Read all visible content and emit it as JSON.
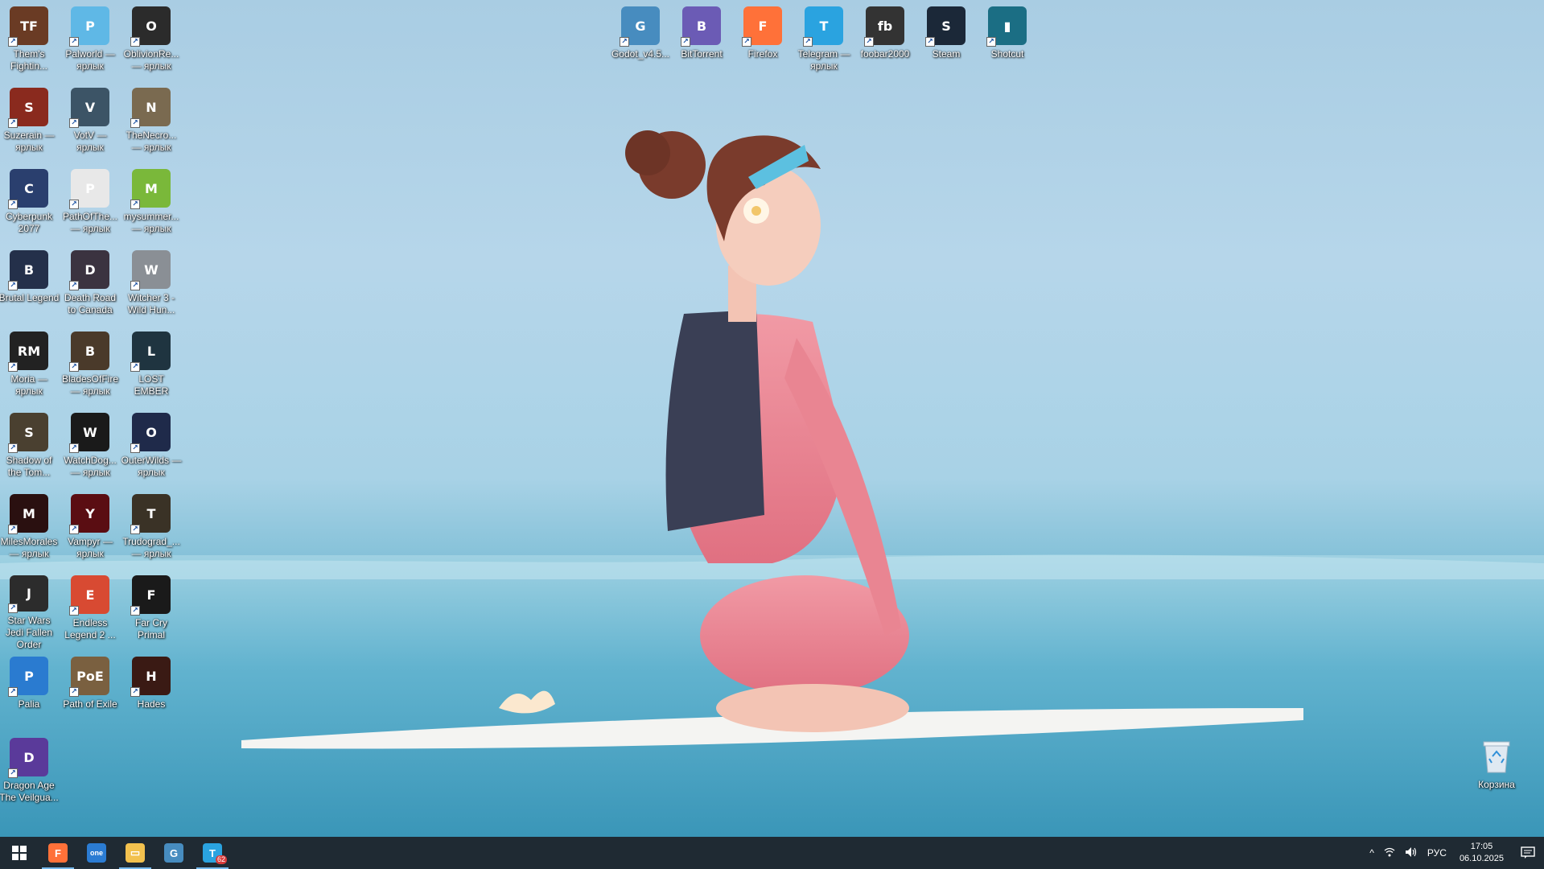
{
  "desktop": {
    "top_icons": [
      {
        "label": "Godot_v4.5...",
        "icon": "godot-icon",
        "color": "#478cbf",
        "glyph": "G"
      },
      {
        "label": "BitTorrent",
        "icon": "bittorrent-icon",
        "color": "#6b5bb5",
        "glyph": "B"
      },
      {
        "label": "Firefox",
        "icon": "firefox-icon",
        "color": "#ff7139",
        "glyph": "F"
      },
      {
        "label": "Telegram — ярлык",
        "icon": "telegram-icon",
        "color": "#2aa3e0",
        "glyph": "T"
      },
      {
        "label": "foobar2000",
        "icon": "foobar-icon",
        "color": "#333333",
        "glyph": "fb"
      },
      {
        "label": "Steam",
        "icon": "steam-icon",
        "color": "#1b2838",
        "glyph": "S"
      },
      {
        "label": "Shotcut",
        "icon": "shotcut-icon",
        "color": "#1b6e84",
        "glyph": "▮"
      }
    ],
    "column_icons": [
      {
        "label": "Them's Fightin...",
        "icon": "thems-fightin-herds-icon",
        "color": "#6a3b24",
        "glyph": "TF"
      },
      {
        "label": "Palworld — ярлык",
        "icon": "palworld-icon",
        "color": "#5fb8e6",
        "glyph": "P"
      },
      {
        "label": "OblivionRe... — ярлык",
        "icon": "oblivion-icon",
        "color": "#2b2b2b",
        "glyph": "O"
      },
      {
        "label": "Suzerain — ярлык",
        "icon": "suzerain-icon",
        "color": "#8a2a1e",
        "glyph": "S"
      },
      {
        "label": "VotV — ярлык",
        "icon": "votv-icon",
        "color": "#3c5466",
        "glyph": "V"
      },
      {
        "label": "TheNecro... — ярлык",
        "icon": "necromancer-icon",
        "color": "#7a6a50",
        "glyph": "N"
      },
      {
        "label": "Cyberpunk 2077",
        "icon": "cyberpunk-icon",
        "color": "#2a3f6e",
        "glyph": "C"
      },
      {
        "label": "PathOfThe... — ярлык",
        "icon": "path-of-the-icon",
        "color": "#e8e8e8",
        "glyph": "P"
      },
      {
        "label": "mysummer... — ярлык",
        "icon": "my-summer-car-icon",
        "color": "#7ab83a",
        "glyph": "M"
      },
      {
        "label": "Brutal Legend",
        "icon": "brutal-legend-icon",
        "color": "#24304a",
        "glyph": "B"
      },
      {
        "label": "Death Road to Canada",
        "icon": "death-road-icon",
        "color": "#3b3340",
        "glyph": "D"
      },
      {
        "label": "Witcher 3 - Wild Hun...",
        "icon": "witcher-icon",
        "color": "#8a8f95",
        "glyph": "W"
      },
      {
        "label": "Moria — ярлык",
        "icon": "moria-icon",
        "color": "#222222",
        "glyph": "RM"
      },
      {
        "label": "BladesOfFire — ярлык",
        "icon": "blades-of-fire-icon",
        "color": "#4a3a2a",
        "glyph": "B"
      },
      {
        "label": "LOST EMBER",
        "icon": "lost-ember-icon",
        "color": "#1f3440",
        "glyph": "L"
      },
      {
        "label": "Shadow of the Tom...",
        "icon": "shadow-tomb-raider-icon",
        "color": "#4a4030",
        "glyph": "S"
      },
      {
        "label": "WatchDog... — ярлык",
        "icon": "watch-dogs-icon",
        "color": "#1a1a1a",
        "glyph": "W"
      },
      {
        "label": "OuterWilds — ярлык",
        "icon": "outer-wilds-icon",
        "color": "#1f2a4a",
        "glyph": "O"
      },
      {
        "label": "MilesMorales — ярлык",
        "icon": "miles-morales-icon",
        "color": "#2a1010",
        "glyph": "M"
      },
      {
        "label": "Vampyr — ярлык",
        "icon": "vampyr-icon",
        "color": "#5a0d12",
        "glyph": "Y"
      },
      {
        "label": "Trudograd_... — ярлык",
        "icon": "trudograd-icon",
        "color": "#3a3226",
        "glyph": "T"
      },
      {
        "label": "Star Wars Jedi Fallen Order",
        "icon": "star-wars-jedi-icon",
        "color": "#2c2c2c",
        "glyph": "J"
      },
      {
        "label": "Endless Legend 2 ...",
        "icon": "endless-legend-icon",
        "color": "#d84a32",
        "glyph": "E"
      },
      {
        "label": "Far Cry Primal",
        "icon": "far-cry-primal-icon",
        "color": "#1a1a1a",
        "glyph": "F"
      },
      {
        "label": "Palia",
        "icon": "palia-icon",
        "color": "#2a7bd0",
        "glyph": "P"
      },
      {
        "label": "Path of Exile",
        "icon": "path-of-exile-icon",
        "color": "#7a6040",
        "glyph": "PoE"
      },
      {
        "label": "Hades",
        "icon": "hades-icon",
        "color": "#3a1a14",
        "glyph": "H"
      },
      {
        "label": "Dragon Age The Veilgua...",
        "icon": "dragon-age-icon",
        "color": "#5a3a9a",
        "glyph": "D"
      }
    ],
    "recycle_bin": {
      "label": "Корзина",
      "icon": "recycle-bin-icon"
    }
  },
  "taskbar": {
    "items": [
      {
        "name": "start-button",
        "icon": "windows-start-icon",
        "color": "#ffffff",
        "glyph": "⊞",
        "running": false,
        "badge": ""
      },
      {
        "name": "taskbar-firefox",
        "icon": "firefox-icon",
        "color": "#ff7139",
        "glyph": "F",
        "running": true,
        "badge": ""
      },
      {
        "name": "taskbar-onenote",
        "icon": "onenote-icon",
        "color": "#2b7cd3",
        "glyph": "one",
        "running": false,
        "badge": ""
      },
      {
        "name": "taskbar-explorer",
        "icon": "file-explorer-icon",
        "color": "#f2c14e",
        "glyph": "▭",
        "running": true,
        "badge": ""
      },
      {
        "name": "taskbar-godot",
        "icon": "godot-icon",
        "color": "#478cbf",
        "glyph": "G",
        "running": false,
        "badge": ""
      },
      {
        "name": "taskbar-telegram",
        "icon": "telegram-icon",
        "color": "#2aa3e0",
        "glyph": "T",
        "running": true,
        "badge": "62"
      }
    ],
    "tray": {
      "chevron": "^",
      "network": "network-icon",
      "volume": "volume-icon",
      "language": "РУС",
      "time": "17:05",
      "date": "06.10.2025",
      "notifications": "notification-center-icon"
    }
  }
}
